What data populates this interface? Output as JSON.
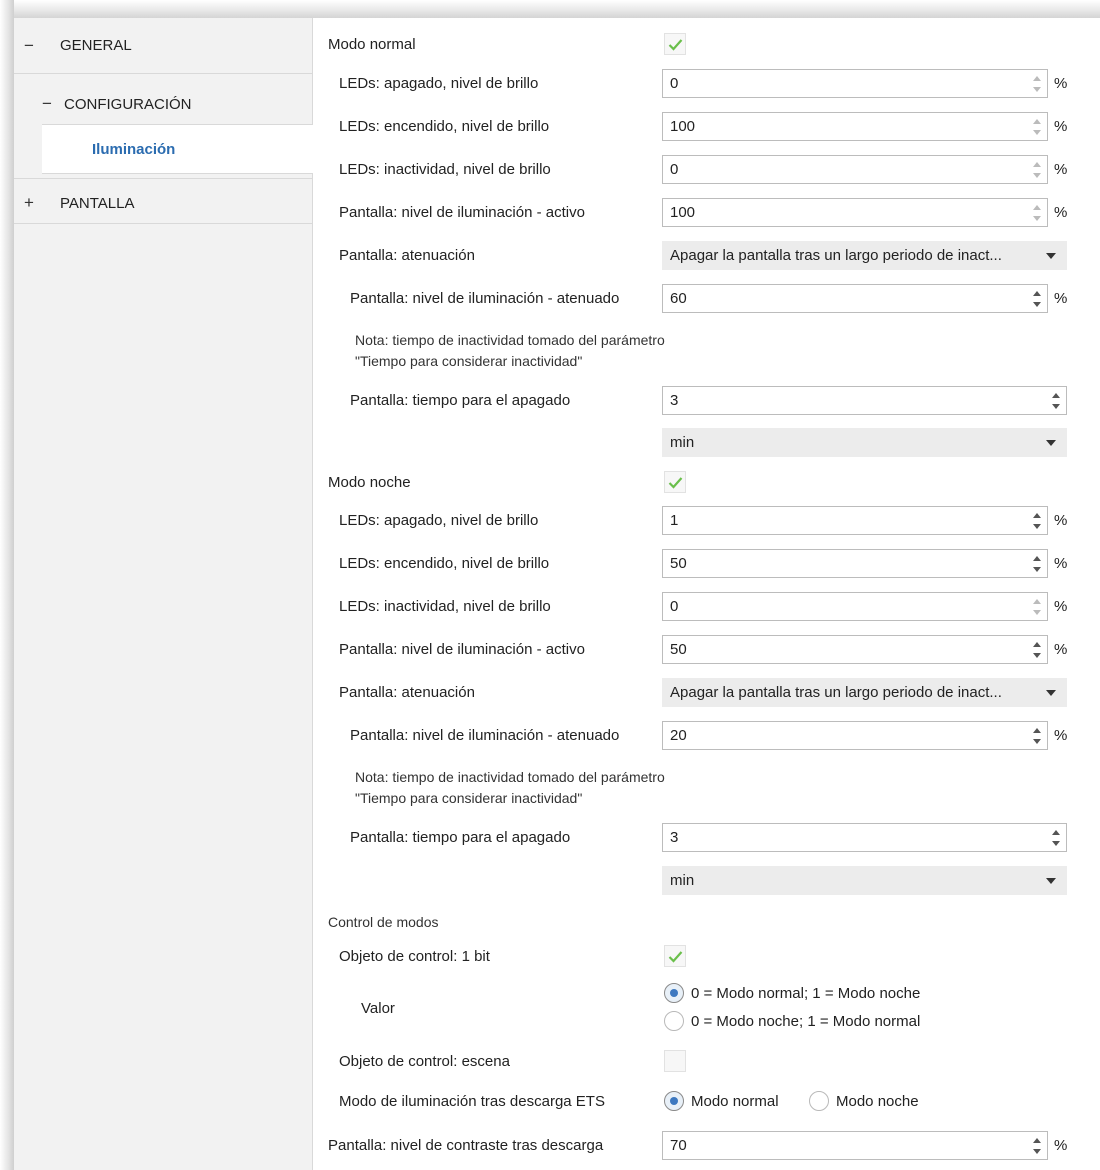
{
  "sidebar": {
    "general": {
      "sign": "−",
      "label": "GENERAL"
    },
    "configuracion": {
      "sign": "−",
      "label": "CONFIGURACIÓN"
    },
    "iluminacion": {
      "label": "Iluminación"
    },
    "pantalla": {
      "sign": "+",
      "label": "PANTALLA"
    }
  },
  "normal": {
    "title": "Modo normal",
    "checked": true,
    "led_off": {
      "label": "LEDs: apagado, nivel de brillo",
      "value": "0",
      "unit": "%"
    },
    "led_on": {
      "label": "LEDs: encendido, nivel de brillo",
      "value": "100",
      "unit": "%"
    },
    "led_idle": {
      "label": "LEDs: inactividad, nivel de brillo",
      "value": "0",
      "unit": "%"
    },
    "screen_active": {
      "label": "Pantalla: nivel de iluminación - activo",
      "value": "100",
      "unit": "%"
    },
    "dimming": {
      "label": "Pantalla: atenuación",
      "value": "Apagar la pantalla tras un largo periodo de inact..."
    },
    "screen_dimmed": {
      "label": "Pantalla: nivel de iluminación - atenuado",
      "value": "60",
      "unit": "%"
    },
    "note_line1": "Nota: tiempo de inactividad tomado del parámetro",
    "note_line2": "\"Tiempo para considerar inactividad\"",
    "off_time": {
      "label": "Pantalla: tiempo para el apagado",
      "value": "3"
    },
    "off_time_unit": {
      "value": "min"
    }
  },
  "night": {
    "title": "Modo noche",
    "checked": true,
    "led_off": {
      "label": "LEDs: apagado, nivel de brillo",
      "value": "1",
      "unit": "%"
    },
    "led_on": {
      "label": "LEDs: encendido, nivel de brillo",
      "value": "50",
      "unit": "%"
    },
    "led_idle": {
      "label": "LEDs: inactividad, nivel de brillo",
      "value": "0",
      "unit": "%"
    },
    "screen_active": {
      "label": "Pantalla: nivel de iluminación - activo",
      "value": "50",
      "unit": "%"
    },
    "dimming": {
      "label": "Pantalla: atenuación",
      "value": "Apagar la pantalla tras un largo periodo de inact..."
    },
    "screen_dimmed": {
      "label": "Pantalla: nivel de iluminación - atenuado",
      "value": "20",
      "unit": "%"
    },
    "note_line1": "Nota: tiempo de inactividad tomado del parámetro",
    "note_line2": "\"Tiempo para considerar inactividad\"",
    "off_time": {
      "label": "Pantalla: tiempo para el apagado",
      "value": "3"
    },
    "off_time_unit": {
      "value": "min"
    }
  },
  "modes": {
    "title": "Control de modos",
    "obj_1bit": {
      "label": "Objeto de control: 1 bit",
      "checked": true
    },
    "valor": {
      "label": "Valor",
      "option1": "0 = Modo normal; 1 = Modo noche",
      "option2": "0 = Modo noche; 1 = Modo normal",
      "selected": 1
    },
    "obj_scene": {
      "label": "Objeto de control: escena",
      "checked": false
    },
    "after_download": {
      "label": "Modo de iluminación tras descarga ETS",
      "option1": "Modo normal",
      "option2": "Modo noche",
      "selected": 1
    },
    "contrast": {
      "label": "Pantalla: nivel de contraste tras descarga",
      "value": "70",
      "unit": "%"
    }
  },
  "colors": {
    "accent": "#2b6cb0",
    "check": "#6abf4b",
    "radio": "#3d78c0"
  }
}
